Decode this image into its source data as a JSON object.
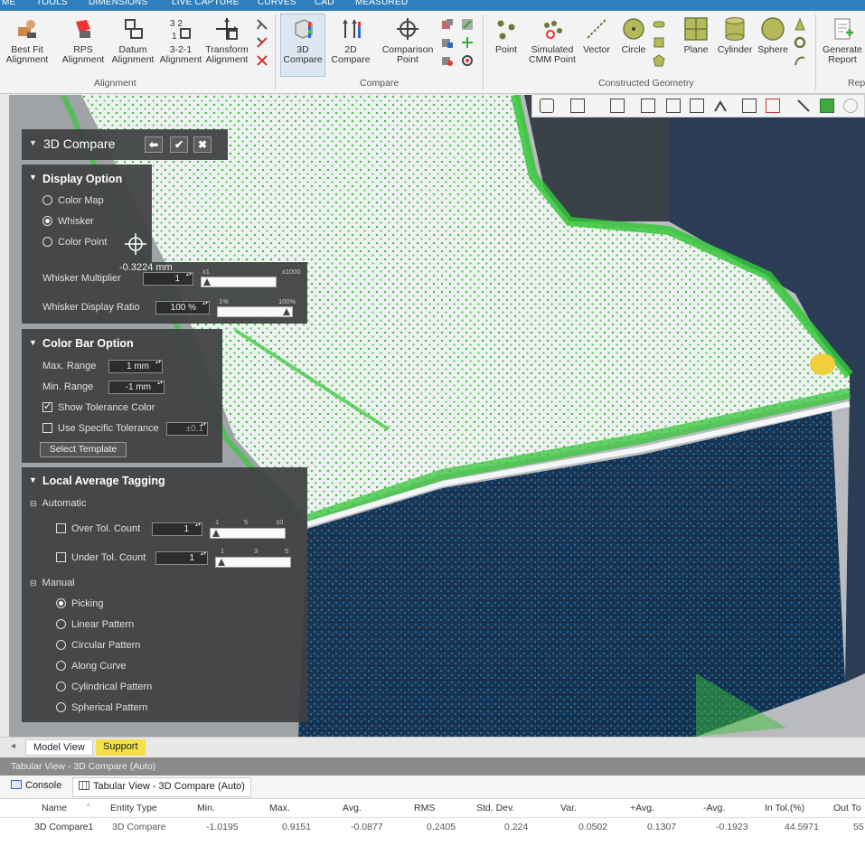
{
  "ribbon": {
    "tabs": [
      "ME",
      "TOOLS",
      "DIMENSIONS",
      "LIVE CAPTURE",
      "CURVES",
      "CAD",
      "MEASURED"
    ],
    "alignment_buttons": [
      "Best Fit\nAlignment",
      "RPS\nAlignment",
      "Datum\nAlignment",
      "3-2-1\nAlignment",
      "Transform\nAlignment"
    ],
    "compare_buttons": [
      "3D\nCompare",
      "2D\nCompare",
      "Comparison\nPoint"
    ],
    "geometry_buttons": [
      "Point",
      "Simulated\nCMM Point",
      "Vector",
      "Circle",
      "Plane",
      "Cylinder",
      "Sphere"
    ],
    "report_button": "Generate\nReport",
    "group_labels": {
      "alignment": "Alignment",
      "compare": "Compare",
      "constructed": "Constructed Geometry",
      "report": "Rep"
    }
  },
  "panel": {
    "title": "3D Compare",
    "display_option": {
      "header": "Display Option",
      "options": [
        "Color Map",
        "Whisker",
        "Color Point"
      ],
      "selected": "Whisker",
      "cursor_readout": "-0.3224 mm",
      "whisker_multiplier_label": "Whisker Multiplier",
      "whisker_multiplier_value": "1",
      "whisker_multiplier_ticks": [
        "x1",
        "x1000"
      ],
      "whisker_display_ratio_label": "Whisker Display Ratio",
      "whisker_display_ratio_value": "100 %",
      "whisker_display_ratio_ticks": [
        "1%",
        "100%"
      ]
    },
    "color_bar": {
      "header": "Color Bar Option",
      "max_label": "Max. Range",
      "max_value": "1 mm",
      "min_label": "Min. Range",
      "min_value": "-1 mm",
      "show_tolerance_label": "Show Tolerance Color",
      "show_tolerance_checked": true,
      "use_specific_label": "Use Specific Tolerance",
      "use_specific_checked": false,
      "use_specific_value": "±0.1",
      "template_button": "Select Template"
    },
    "local_avg": {
      "header": "Local Average Tagging",
      "automatic": "Automatic",
      "over_label": "Over Tol. Count",
      "over_value": "1",
      "over_ticks": [
        "1",
        "5",
        "10"
      ],
      "under_label": "Under Tol. Count",
      "under_value": "1",
      "under_ticks": [
        "1",
        "3",
        "5"
      ],
      "manual": "Manual",
      "manual_options": [
        "Picking",
        "Linear Pattern",
        "Circular Pattern",
        "Along Curve",
        "Cylindrical Pattern",
        "Spherical Pattern"
      ],
      "manual_selected": "Picking"
    }
  },
  "bottom_tabs": [
    "Model View",
    "Support"
  ],
  "tabular": {
    "title": "Tabular View - 3D Compare (Auto)",
    "tabs": [
      "Console",
      "Tabular View - 3D Compare (Auto)"
    ],
    "columns": [
      "Name",
      "Entity Type",
      "Min.",
      "Max.",
      "Avg.",
      "RMS",
      "Std. Dev.",
      "Var.",
      "+Avg.",
      "-Avg.",
      "In Tol.(%)",
      "Out To"
    ],
    "rows": [
      [
        "3D Compare1",
        "3D Compare",
        "-1.0195",
        "0.9151",
        "-0.0877",
        "0.2405",
        "0.224",
        "0.0502",
        "0.1307",
        "-0.1923",
        "44.5971",
        "55"
      ]
    ]
  },
  "colors": {
    "accent": "#2f7fbf",
    "panel_bg": "#3e4042",
    "support_tab": "#f5e04a"
  }
}
